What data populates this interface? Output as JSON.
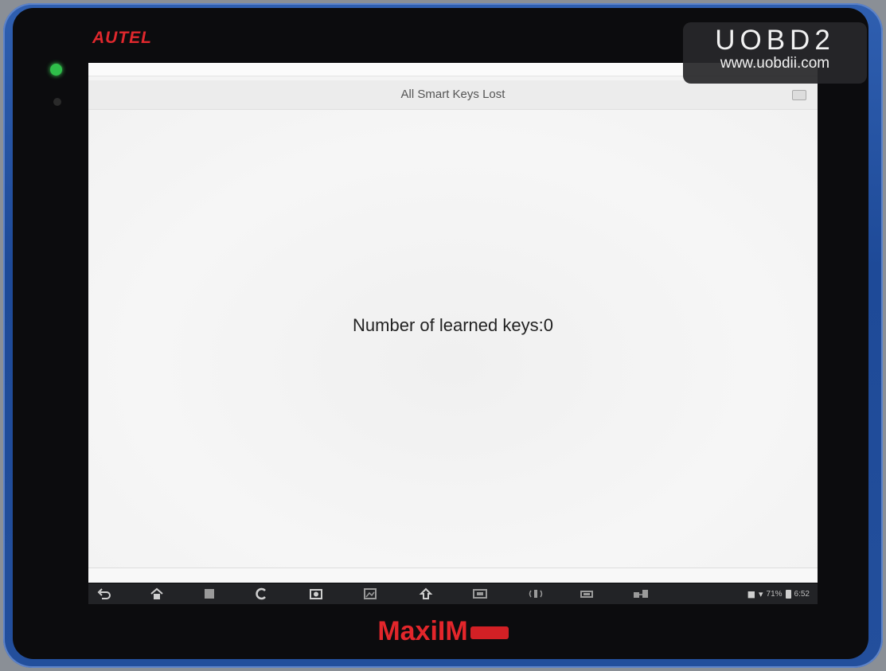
{
  "device": {
    "brand": "AUTEL",
    "product": "MaxiIM"
  },
  "screen": {
    "title": "All Smart Keys Lost",
    "message": "Number of learned keys:0"
  },
  "nav_bar": {
    "buttons": [
      {
        "name": "back-icon",
        "glyph": "⮌"
      },
      {
        "name": "home-icon",
        "glyph": "⌂"
      },
      {
        "name": "recent-apps-icon",
        "glyph": "▮"
      },
      {
        "name": "chrome-icon",
        "glyph": "◔"
      },
      {
        "name": "camera-icon",
        "glyph": "◙"
      },
      {
        "name": "screenshot-icon",
        "glyph": "▨"
      },
      {
        "name": "vci-upload-icon",
        "glyph": "⇧"
      },
      {
        "name": "vci-icon",
        "glyph": "▭"
      },
      {
        "name": "signal-icon",
        "glyph": "⚟"
      },
      {
        "name": "car-icon",
        "glyph": "⛍"
      },
      {
        "name": "pc-link-icon",
        "glyph": "⚌"
      }
    ],
    "status": {
      "time": "6:52",
      "battery_percent": "71%"
    }
  },
  "watermark": {
    "brand": "UOBD2",
    "url": "www.uobdii.com"
  },
  "colors": {
    "brand_red": "#e3262b",
    "shell_blue": "#2a5aab",
    "screen_bg": "#f4f4f4",
    "nav_bg": "#222326"
  }
}
